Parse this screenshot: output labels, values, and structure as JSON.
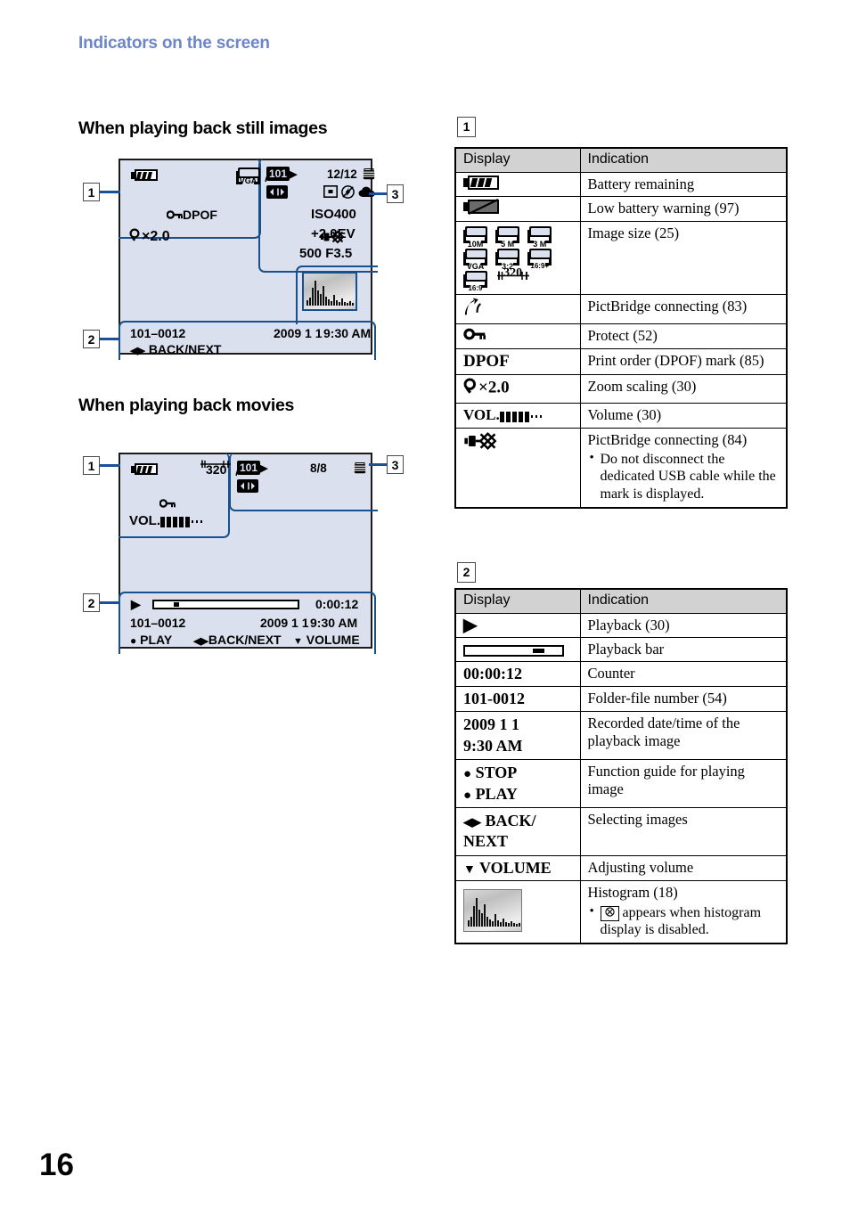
{
  "header": {
    "title": "Indicators on the screen"
  },
  "page_number": "16",
  "sections": {
    "still": {
      "title": "When playing back still images"
    },
    "movie": {
      "title": "When playing back movies"
    }
  },
  "markers": {
    "one": "1",
    "two": "2",
    "three": "3"
  },
  "lcd_still": {
    "image_size_tag": "VGA",
    "folder": "101",
    "image_count": "12/12",
    "protect_dpof": "DPOF",
    "zoom": "×2.0",
    "iso": "ISO400",
    "ev": "+2.0EV",
    "shutter_aperture": "500  F3.5",
    "folder_file": "101–0012",
    "date": "2009 1 1",
    "time": "9:30 AM",
    "guide": "BACK/NEXT"
  },
  "lcd_movie": {
    "movie_size": "320",
    "folder": "101",
    "image_count": "8/8",
    "volume_label": "VOL.",
    "counter": "0:00:12",
    "folder_file": "101–0012",
    "date": "2009 1 1",
    "time": "9:30 AM",
    "guide_play": "PLAY",
    "guide_backnext": "BACK/NEXT",
    "guide_volume": "VOLUME"
  },
  "table1": {
    "marker": "1",
    "headers": {
      "display": "Display",
      "indication": "Indication"
    },
    "rows": [
      {
        "display_kind": "battery-full",
        "indication": "Battery remaining"
      },
      {
        "display_kind": "battery-low",
        "indication": "Low battery warning (97)"
      },
      {
        "display_kind": "image-sizes",
        "sizes": [
          "10M",
          "5 M",
          "3 M",
          "VGA",
          "3:2",
          "16:9+",
          "16:9"
        ],
        "movie_size": "320",
        "indication": "Image size (25)"
      },
      {
        "display_kind": "pictbridge-hook",
        "indication": "PictBridge connecting (83)"
      },
      {
        "display_kind": "key",
        "indication": "Protect (52)"
      },
      {
        "display_kind": "text",
        "display_text": "DPOF",
        "indication": "Print order (DPOF) mark (85)"
      },
      {
        "display_kind": "zoom",
        "display_text": "×2.0",
        "indication": "Zoom scaling (30)"
      },
      {
        "display_kind": "volume",
        "display_text": "VOL.",
        "indication": "Volume (30)"
      },
      {
        "display_kind": "pictbridge-usb",
        "indication": "PictBridge connecting (84)",
        "notes": [
          "Do not disconnect the dedicated USB cable while the mark is displayed."
        ]
      }
    ]
  },
  "table2": {
    "marker": "2",
    "headers": {
      "display": "Display",
      "indication": "Indication"
    },
    "rows": [
      {
        "display_kind": "play-triangle",
        "indication": "Playback (30)"
      },
      {
        "display_kind": "playback-bar",
        "indication": "Playback bar"
      },
      {
        "display_kind": "text",
        "display_text": "00:00:12",
        "indication": "Counter"
      },
      {
        "display_kind": "text",
        "display_text": "101-0012",
        "indication": "Folder-file number (54)"
      },
      {
        "display_kind": "text2",
        "display_text": "2009 1 1",
        "display_text2": "9:30 AM",
        "indication": "Recorded date/time of the playback image"
      },
      {
        "display_kind": "guide2",
        "display_text": "STOP",
        "display_text2": "PLAY",
        "indication": "Function guide for playing image"
      },
      {
        "display_kind": "arrows",
        "display_text": "BACK/",
        "display_text2": "NEXT",
        "indication": "Selecting images"
      },
      {
        "display_kind": "down-arrow",
        "display_text": "VOLUME",
        "indication": "Adjusting volume"
      },
      {
        "display_kind": "histogram",
        "indication": "Histogram (18)",
        "notes_prefix": "appears when histogram display is disabled."
      }
    ]
  },
  "colors": {
    "heading_blue": "#6d86c9",
    "lcd_bg": "#dbe0ee",
    "group_outline": "#17508f",
    "table_header_gray": "#d2d2d2"
  }
}
